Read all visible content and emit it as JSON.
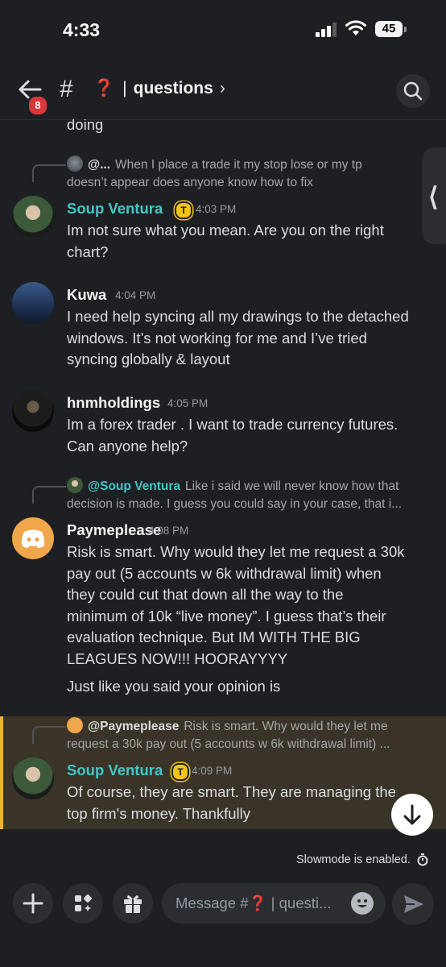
{
  "status_bar": {
    "time": "4:33",
    "battery": "45"
  },
  "header": {
    "back_badge": "8",
    "channel_prefix": "#",
    "channel_emoji": "❓",
    "channel_bar": "|",
    "channel_name": "questions",
    "chevron": "›"
  },
  "messages": {
    "prev_tail": "doing",
    "m1": {
      "reply_user": "@...",
      "reply_text_1": "When I place a trade it my stop lose or my tp",
      "reply_text_2": "doesn’t appear does anyone know how to fix",
      "author": "Soup Ventura",
      "badge": "T",
      "time": "4:03 PM",
      "line1": "Im not sure what you mean. Are you on the right",
      "line2": "chart?"
    },
    "m2": {
      "author": "Kuwa",
      "time": "4:04 PM",
      "line1": "I need help syncing all my drawings to the detached",
      "line2": "windows. It’s not working for me and I’ve tried",
      "line3": "syncing globally & layout"
    },
    "m3": {
      "author": "hnmholdings",
      "time": "4:05 PM",
      "line1": "Im a forex trader . I want to trade currency futures.",
      "line2": "Can anyone help?"
    },
    "m4": {
      "reply_user": "@Soup Ventura",
      "reply_text_1": "Like i said we will never know how that",
      "reply_text_2": "decision is made. I guess you could say in your case, that i...",
      "author": "Paymeplease",
      "time": "4:08 PM",
      "line1": "Risk is smart. Why would they let me request a 30k",
      "line2": "pay out (5 accounts w 6k withdrawal limit) when",
      "line3": "they could cut that down all the way to the",
      "line4": "minimum of 10k “live money”. I guess that’s their",
      "line5": "evaluation technique. But IM WITH THE BIG",
      "line6": "LEAGUES NOW!!! HOORAYYYY",
      "line7": "Just like you said your opinion is"
    },
    "m5": {
      "reply_user": "@Paymeplease",
      "reply_text_1": "Risk is smart. Why would they let me",
      "reply_text_2": "request a 30k pay out (5 accounts w 6k withdrawal limit) ...",
      "author": "Soup Ventura",
      "badge": "T",
      "time": "4:09 PM",
      "line1": "Of course, they are smart. They are managing the",
      "line2": "top firm's money. Thankfully"
    }
  },
  "side_tab_glyph": "⟨",
  "slowmode_text": "Slowmode is enabled.",
  "composer": {
    "placeholder_prefix": "Message #",
    "placeholder_emoji": "❓",
    "placeholder_suffix": " | questi..."
  },
  "colors": {
    "background": "#1e1f22",
    "teal_name": "#40c8c8",
    "highlight": "#3a3428",
    "highlight_border": "#f0b232",
    "discord_orange": "#f0a64b"
  },
  "icons": [
    "back-arrow-icon",
    "hash-icon",
    "search-icon",
    "plus-icon",
    "apps-icon",
    "gift-icon",
    "emoji-icon",
    "send-icon",
    "arrow-down-icon",
    "timer-icon"
  ]
}
